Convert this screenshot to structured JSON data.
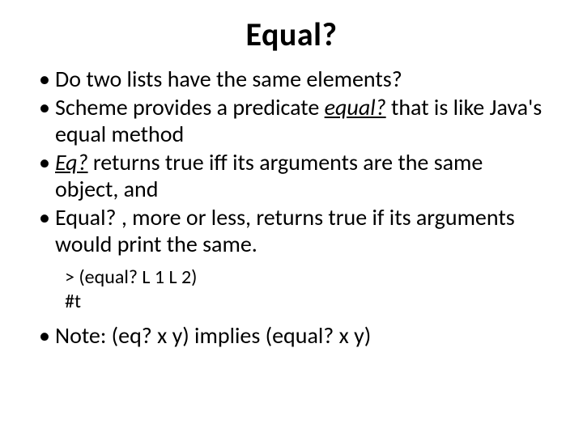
{
  "title": "Equal?",
  "bullets": {
    "b1": "Do two lists have the same elements?",
    "b2a": "Scheme provides a predicate ",
    "b2b": "equal?",
    "b2c": " that is like Java's equal method",
    "b3a": "Eq?",
    "b3b": " returns true iff its arguments are the same object, and",
    "b4": "Equal? , more or less, returns true if its arguments would print the same.",
    "b5": "Note: (eq? x y) implies (equal? x y)"
  },
  "code": {
    "l1": "> (equal? L 1 L 2)",
    "l2": "#t"
  }
}
